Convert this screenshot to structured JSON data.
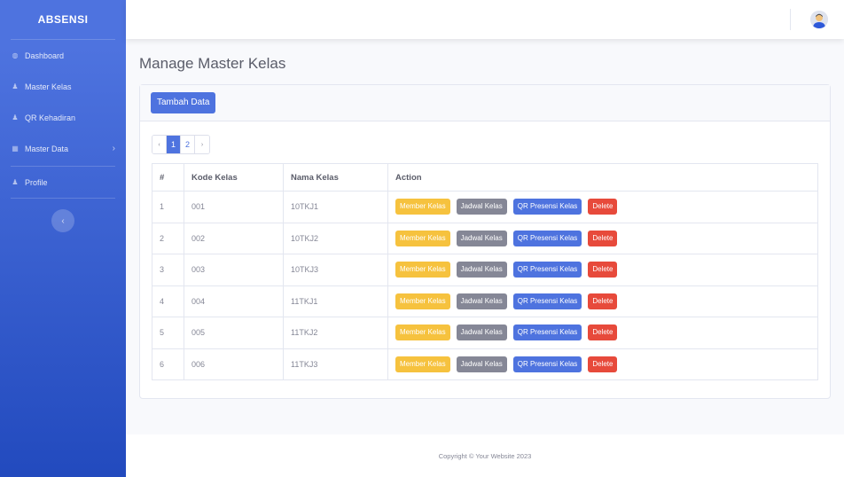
{
  "brand": "ABSENSI",
  "sidebar": {
    "items": [
      {
        "label": "Dashboard",
        "icon": "tachometer-icon"
      },
      {
        "label": "Master Kelas",
        "icon": "user-icon"
      },
      {
        "label": "QR Kehadiran",
        "icon": "user-icon"
      },
      {
        "label": "Master Data",
        "icon": "table-icon",
        "chevron": "›"
      },
      {
        "label": "Profile",
        "icon": "user-icon"
      }
    ],
    "toggle": "‹"
  },
  "header": {
    "avatar": "user-avatar"
  },
  "page_title": "Manage Master Kelas",
  "actions": {
    "add_label": "Tambah Data"
  },
  "pagination": {
    "prev": "‹",
    "next": "›",
    "pages": [
      "1",
      "2"
    ],
    "current": "1"
  },
  "table": {
    "headers": [
      "#",
      "Kode Kelas",
      "Nama Kelas",
      "Action"
    ],
    "row_actions": [
      "Member Kelas",
      "Jadwal Kelas",
      "QR Presensi Kelas",
      "Delete"
    ],
    "rows": [
      {
        "no": "1",
        "kode": "001",
        "nama": "10TKJ1"
      },
      {
        "no": "2",
        "kode": "002",
        "nama": "10TKJ2"
      },
      {
        "no": "3",
        "kode": "003",
        "nama": "10TKJ3"
      },
      {
        "no": "4",
        "kode": "004",
        "nama": "11TKJ1"
      },
      {
        "no": "5",
        "kode": "005",
        "nama": "11TKJ2"
      },
      {
        "no": "6",
        "kode": "006",
        "nama": "11TKJ3"
      }
    ]
  },
  "footer": "Copyright © Your Website 2023",
  "colors": {
    "primary": "#4e73df",
    "warning": "#f6c23e",
    "secondary": "#858796",
    "danger": "#e74a3b"
  }
}
